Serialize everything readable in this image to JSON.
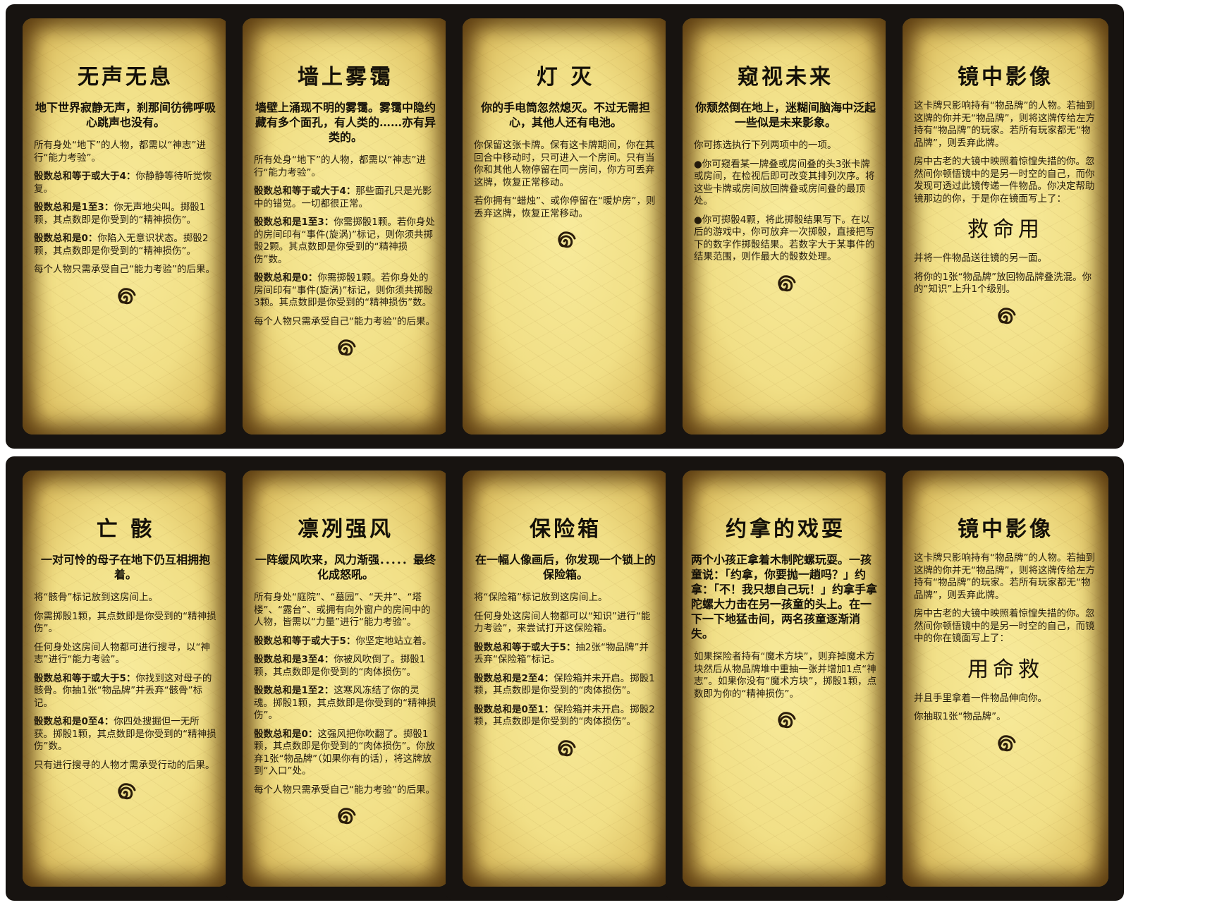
{
  "cards": [
    {
      "title": "无声无息",
      "flavor": "地下世界寂静无声，刹那间彷彿呼吸心跳声也没有。",
      "rules": [
        {
          "t": "所有身处“地下”的人物，都需以“神志”进行“能力考验”。"
        },
        {
          "b": "骰数总和等于或大于4：",
          "t": "你静静等待听觉恢复。"
        },
        {
          "b": "骰数总和是1至3：",
          "t": "你无声地尖叫。掷骰1颗，其点数即是你受到的“精神损伤”。"
        },
        {
          "b": "骰数总和是0：",
          "t": "你陷入无意识状态。掷骰2颗，其点数即是你受到的“精神损伤”。"
        },
        {
          "t": "每个人物只需承受自己“能力考验”的后果。"
        }
      ]
    },
    {
      "title": "墙上雾霭",
      "flavor": "墙壁上涌现不明的雾霭。雾霭中隐约藏有多个面孔，有人类的……亦有异类的。",
      "rules": [
        {
          "t": "所有处身“地下”的人物，都需以“神志”进行“能力考验”。"
        },
        {
          "b": "骰数总和等于或大于4：",
          "t": "那些面孔只是光影中的错觉。一切都很正常。"
        },
        {
          "b": "骰数总和是1至3：",
          "t": "你需掷骰1颗。若你身处的房间印有“事件(旋涡)”标记，则你须共掷骰2颗。其点数即是你受到的“精神损伤”数。"
        },
        {
          "b": "骰数总和是0：",
          "t": "你需掷骰1颗。若你身处的房间印有“事件(旋涡)”标记，则你须共掷骰3颗。其点数即是你受到的“精神损伤”数。"
        },
        {
          "t": "每个人物只需承受自己“能力考验”的后果。"
        }
      ]
    },
    {
      "title": "灯 灭",
      "flavor": "你的手电筒忽然熄灭。不过无需担心，其他人还有电池。",
      "rules": [
        {
          "t": "你保留这张卡牌。保有这卡牌期间，你在其回合中移动时，只可进入一个房间。只有当你和其他人物停留在同一房间，你方可丢弃这牌，恢复正常移动。"
        },
        {
          "t": "若你拥有“蜡烛”、或你停留在“暖炉房”，则丢弃这牌，恢复正常移动。"
        }
      ]
    },
    {
      "title": "窥视未来",
      "flavor": "你颓然倒在地上，迷糊间脑海中泛起一些似是未来影象。",
      "rules": [
        {
          "t": "你可拣选执行下列两项中的一项。"
        },
        {
          "t": "●你可窥看某一牌叠或房间叠的头3张卡牌或房间，在检视后即可改变其排列次序。将这些卡牌或房间放回牌叠或房间叠的最顶处。"
        },
        {
          "t": "●你可掷骰4颗，将此掷骰结果写下。在以后的游戏中，你可放弃一次掷骰，直接把写下的数字作掷骰结果。若数字大于某事件的结果范围，则作最大的骰数处理。"
        }
      ]
    },
    {
      "title": "镜中影像",
      "flavor": "",
      "rules": [
        {
          "t": "这卡牌只影响持有“物品牌”的人物。若抽到这牌的你并无“物品牌”，则将这牌传给左方持有“物品牌”的玩家。若所有玩家都无“物品牌”，则丢弃此牌。"
        },
        {
          "t": "房中古老的大镜中映照着惊惶失措的你。忽然间你顿悟镜中的是另一时空的自己，而你发现可透过此镜传递一件物品。你决定帮助镜那边的你，于是你在镜面写上了："
        }
      ],
      "cursive": "救命用",
      "rules_after": [
        {
          "t": "并将一件物品送往镜的另一面。"
        },
        {
          "t": "将你的1张“物品牌”放回物品牌叠洗混。你的“知识”上升1个级别。"
        }
      ]
    },
    {
      "title": "亡 骸",
      "flavor": "一对可怜的母子在地下仍互相拥抱着。",
      "rules": [
        {
          "t": "将“骸骨”标记放到这房间上。"
        },
        {
          "t": "你需掷骰1颗，其点数即是你受到的“精神损伤”。"
        },
        {
          "t": "任何身处这房间人物都可进行搜寻，以“神志”进行“能力考验”。"
        },
        {
          "b": "骰数总和等于或大于5：",
          "t": "你找到这对母子的骸骨。你抽1张“物品牌”并丢弃“骸骨”标记。"
        },
        {
          "b": "骰数总和是0至4：",
          "t": "你四处搜掘但一无所获。掷骰1颗，其点数即是你受到的“精神损伤”数。"
        },
        {
          "t": "只有进行搜寻的人物才需承受行动的后果。"
        }
      ]
    },
    {
      "title": "凛冽强风",
      "flavor": "一阵缓风吹来，风力渐强．．．．．最终化成怒吼。",
      "rules": [
        {
          "t": "所有身处“庭院”、“墓园”、“天井”、“塔楼”、“露台”、或拥有向外窗户的房间中的人物，皆需以“力量”进行“能力考验”。"
        },
        {
          "b": "骰数总和等于或大于5：",
          "t": "你坚定地站立着。"
        },
        {
          "b": "骰数总和是3至4：",
          "t": "你被风吹倒了。掷骰1颗，其点数即是你受到的“肉体损伤”。"
        },
        {
          "b": "骰数总和是1至2：",
          "t": "这寒风冻结了你的灵魂。掷骰1颗，其点数即是你受到的“精神损伤”。"
        },
        {
          "b": "骰数总和是0：",
          "t": "这强风把你吹翻了。掷骰1颗，其点数即是你受到的“肉体损伤”。你放弃1张“物品牌”（如果你有的话），将这牌放到“入口”处。"
        },
        {
          "t": "每个人物只需承受自己“能力考验”的后果。"
        }
      ]
    },
    {
      "title": "保险箱",
      "flavor": "在一幅人像画后，你发现一个锁上的保险箱。",
      "rules": [
        {
          "t": "将“保险箱”标记放到这房间上。"
        },
        {
          "t": "任何身处这房间人物都可以“知识”进行“能力考验”，来尝试打开这保险箱。"
        },
        {
          "b": "骰数总和等于或大于5：",
          "t": "抽2张“物品牌”并丢弃“保险箱”标记。"
        },
        {
          "b": "骰数总和是2至4：",
          "t": "保险箱并未开启。掷骰1颗，其点数即是你受到的“肉体损伤”。"
        },
        {
          "b": "骰数总和是0至1：",
          "t": "保险箱并未开启。掷骰2颗，其点数即是你受到的“肉体损伤”。"
        }
      ]
    },
    {
      "title": "约拿的戏耍",
      "flavor": "两个小孩正拿着木制陀螺玩耍。一孩童说：「约拿，你要抛一趟吗？」约拿：「不！我只想自己玩！」约拿手拿陀螺大力击在另一孩童的头上。在一下一下地猛击间，两名孩童逐渐消失。",
      "rules": [
        {
          "t": "如果探险者持有“魔术方块”，则弃掉魔术方块然后从物品牌堆中重抽一张并增加1点“神志”。如果你没有“魔术方块”，掷骰1颗，点数即为你的“精神损伤”。"
        }
      ]
    },
    {
      "title": "镜中影像",
      "flavor": "",
      "rules": [
        {
          "t": "这卡牌只影响持有“物品牌”的人物。若抽到这牌的你并无“物品牌”，则将这牌传给左方持有“物品牌”的玩家。若所有玩家都无“物品牌”，则丢弃此牌。"
        },
        {
          "t": "房中古老的大镜中映照着惊惶失措的你。忽然间你顿悟镜中的是另一时空的自己，而镜中的你在镜面写上了："
        }
      ],
      "cursive": "用命救",
      "rules_after": [
        {
          "t": "并且手里拿着一件物品伸向你。"
        },
        {
          "t": "你抽取1张“物品牌”。"
        }
      ]
    }
  ]
}
